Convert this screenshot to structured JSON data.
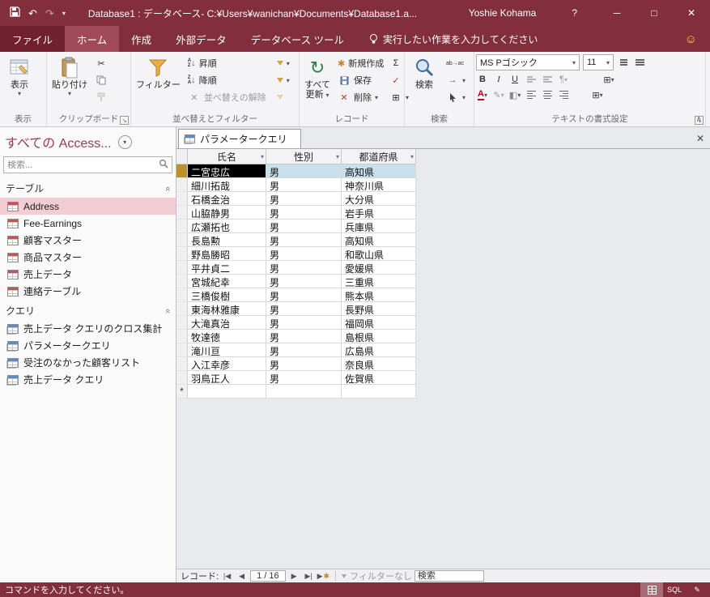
{
  "titlebar": {
    "title": "Database1 : データベース- C:¥Users¥wanichan¥Documents¥Database1.a...",
    "user": "Yoshie Kohama",
    "help": "?",
    "minimize": "─",
    "maximize": "□",
    "close": "✕"
  },
  "tabs": {
    "file": "ファイル",
    "home": "ホーム",
    "create": "作成",
    "external_data": "外部データ",
    "db_tools": "データベース ツール",
    "tell_me": "実行したい作業を入力してください"
  },
  "ribbon": {
    "view": {
      "label": "表示",
      "group_label": "表示"
    },
    "clipboard": {
      "paste": "貼り付け",
      "group_label": "クリップボード"
    },
    "sort_filter": {
      "filter": "フィルター",
      "asc": "昇順",
      "desc": "降順",
      "remove_sort": "並べ替えの解除",
      "group_label": "並べ替えとフィルター"
    },
    "records": {
      "refresh_line1": "すべて",
      "refresh_line2": "更新",
      "new": "新規作成",
      "save": "保存",
      "delete": "削除",
      "group_label": "レコード"
    },
    "find": {
      "find": "検索",
      "replace_icon_text": "ab→ac",
      "group_label": "検索"
    },
    "text_format": {
      "font_name": "MS Pゴシック",
      "font_size": "11",
      "bold": "B",
      "italic": "I",
      "underline": "U",
      "color_letter": "A",
      "group_label": "テキストの書式設定"
    }
  },
  "glyphs": {
    "dropdown": "▾",
    "undo": "↶",
    "redo": "↷",
    "refresh": "↻",
    "scissors": "✂",
    "sigma": "Σ",
    "spellcheck": "✓",
    "delete_x": "✕",
    "grid": "⊞",
    "new_record": "✱",
    "smiley": "☺",
    "chevrons": "«",
    "collapse": "∧",
    "launcher": "↘",
    "goto_arrow": "→",
    "fill": "◧",
    "highlight_pen": "✎",
    "design_pencil": "✎"
  },
  "sidebar": {
    "header": "すべての Access...",
    "search_placeholder": "検索...",
    "sections": [
      {
        "label": "テーブル",
        "type": "table",
        "items": [
          {
            "label": "Address",
            "selected": true
          },
          {
            "label": "Fee-Earnings"
          },
          {
            "label": "顧客マスター"
          },
          {
            "label": "商品マスター"
          },
          {
            "label": "売上データ"
          },
          {
            "label": "連絡テーブル"
          }
        ]
      },
      {
        "label": "クエリ",
        "type": "query",
        "items": [
          {
            "label": "売上データ クエリのクロス集計"
          },
          {
            "label": "パラメータークエリ"
          },
          {
            "label": "受注のなかった顧客リスト"
          },
          {
            "label": "売上データ クエリ"
          }
        ]
      }
    ]
  },
  "document": {
    "tab_label": "パラメータークエリ",
    "close": "✕"
  },
  "table": {
    "columns": [
      "氏名",
      "性別",
      "都道府県"
    ],
    "rows": [
      [
        "二宮忠広",
        "男",
        "高知県"
      ],
      [
        "細川拓哉",
        "男",
        "神奈川県"
      ],
      [
        "石橋金治",
        "男",
        "大分県"
      ],
      [
        "山脇静男",
        "男",
        "岩手県"
      ],
      [
        "広瀬拓也",
        "男",
        "兵庫県"
      ],
      [
        "長島勲",
        "男",
        "高知県"
      ],
      [
        "野島勝昭",
        "男",
        "和歌山県"
      ],
      [
        "平井貞二",
        "男",
        "愛媛県"
      ],
      [
        "宮城紀幸",
        "男",
        "三重県"
      ],
      [
        "三橋俊樹",
        "男",
        "熊本県"
      ],
      [
        "東海林雅康",
        "男",
        "長野県"
      ],
      [
        "大滝真治",
        "男",
        "福岡県"
      ],
      [
        "牧達徳",
        "男",
        "島根県"
      ],
      [
        "滝川亘",
        "男",
        "広島県"
      ],
      [
        "入江幸彦",
        "男",
        "奈良県"
      ],
      [
        "羽鳥正人",
        "男",
        "佐賀県"
      ]
    ],
    "selected_row": 0,
    "new_record_marker": "*"
  },
  "record_nav": {
    "label": "レコード:",
    "position": "1 / 16",
    "buttons": {
      "first": "|◀",
      "prev": "◀",
      "next": "▶",
      "last": "▶|",
      "new": "▶"
    },
    "filter_status": "フィルターなし",
    "search_placeholder": "検索"
  },
  "statusbar": {
    "message": "コマンドを入力してください。",
    "sql_label": "SQL"
  }
}
